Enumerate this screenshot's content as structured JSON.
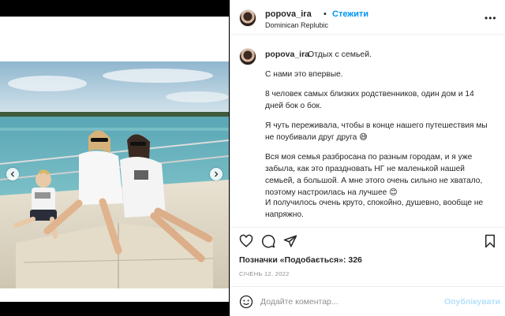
{
  "header": {
    "username": "popova_ira",
    "separator": "•",
    "follow_label": "Стежити",
    "location": "Dominican Replubic",
    "more_icon": "more-horizontal-icon"
  },
  "caption": {
    "username": "popova_ira",
    "paragraphs": [
      "Отдых с семьей.",
      "С нами это впервые.",
      "8 человек самых близких родственников, один дом и 14 дней бок о бок.",
      "Я чуть переживала, чтобы в конце нашего путешествия мы не поубивали друг друга 😅",
      "Вся моя семья разбросана по разным городам, и я уже забыла, как это праздновать НГ не маленькой нашей семьей, а большой. А мне этого очень сильно не хватало, поэтому настроилась на лучшее 😊",
      "И получилось очень круто, спокойно, душевно, вообще не напряжно."
    ]
  },
  "actions": {
    "icons": [
      "heart-icon",
      "comment-icon",
      "share-icon",
      "bookmark-icon"
    ]
  },
  "likes": "Позначки «Подобається»: 326",
  "date": "СІЧЕНЬ 12, 2022",
  "comment": {
    "placeholder": "Додайте коментар...",
    "publish_label": "Опублікувати"
  },
  "colors": {
    "accent": "#0095f6",
    "publish_disabled": "#b2dffc",
    "muted": "#8e8e8e",
    "text": "#262626"
  }
}
